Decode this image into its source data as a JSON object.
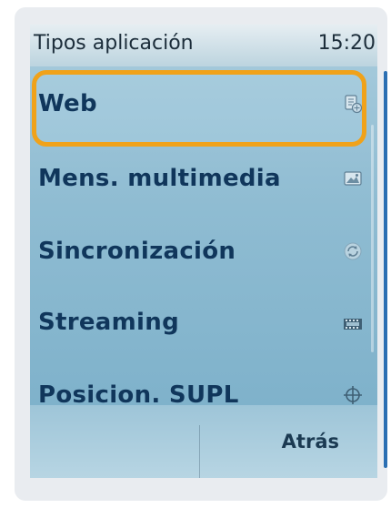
{
  "status_bar": {
    "title": "Tipos aplicación",
    "clock": "15:20"
  },
  "menu": {
    "items": [
      {
        "label": "Web",
        "icon": "web-page-icon",
        "selected": true
      },
      {
        "label": "Mens. multimedia",
        "icon": "mms-picture-icon",
        "selected": false
      },
      {
        "label": "Sincronización",
        "icon": "sync-icon",
        "selected": false
      },
      {
        "label": "Streaming",
        "icon": "film-strip-icon",
        "selected": false
      },
      {
        "label": "Posicion. SUPL",
        "icon": "crosshair-icon",
        "selected": false
      }
    ]
  },
  "softkeys": {
    "right": "Atrás"
  },
  "colors": {
    "highlight": "#f0a21a",
    "label_text": "#10365b",
    "edge_accent": "#2b6fb3"
  }
}
